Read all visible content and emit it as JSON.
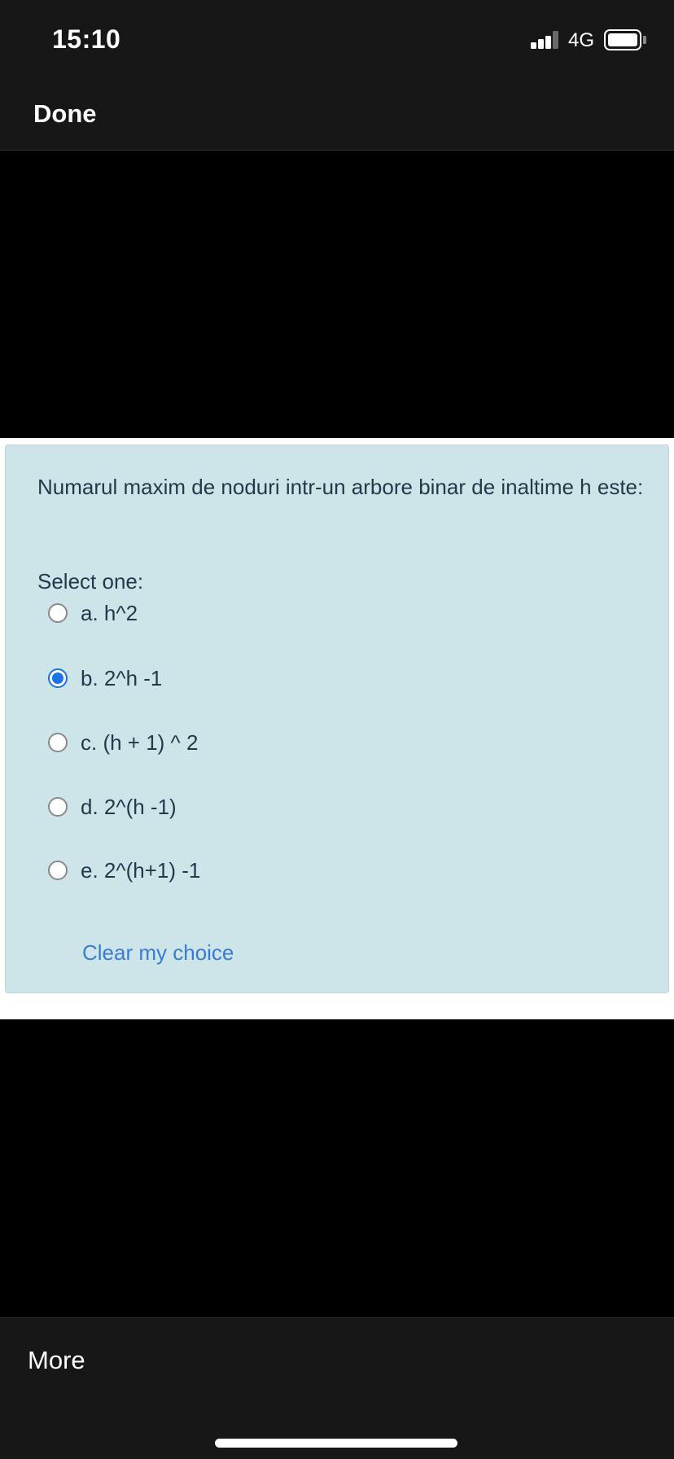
{
  "status_bar": {
    "time": "15:10",
    "network": "4G",
    "signal_bars": 3,
    "icons": [
      "signal-icon",
      "battery-icon"
    ]
  },
  "nav": {
    "done_label": "Done"
  },
  "question": {
    "text": "Numarul maxim de noduri intr-un arbore binar de inaltime h este:",
    "prompt": "Select one:",
    "options": [
      {
        "label": "a. h^2",
        "selected": false
      },
      {
        "label": "b. 2^h -1",
        "selected": true
      },
      {
        "label": "c. (h + 1) ^ 2",
        "selected": false
      },
      {
        "label": "d. 2^(h -1)",
        "selected": false
      },
      {
        "label": "e. 2^(h+1) -1",
        "selected": false
      }
    ],
    "clear_label": "Clear my choice"
  },
  "bottom": {
    "more_label": "More"
  },
  "colors": {
    "card_background": "#cde4e8",
    "selected_radio": "#1a73e8",
    "link": "#3a7bd5",
    "bar_background": "#171717"
  }
}
